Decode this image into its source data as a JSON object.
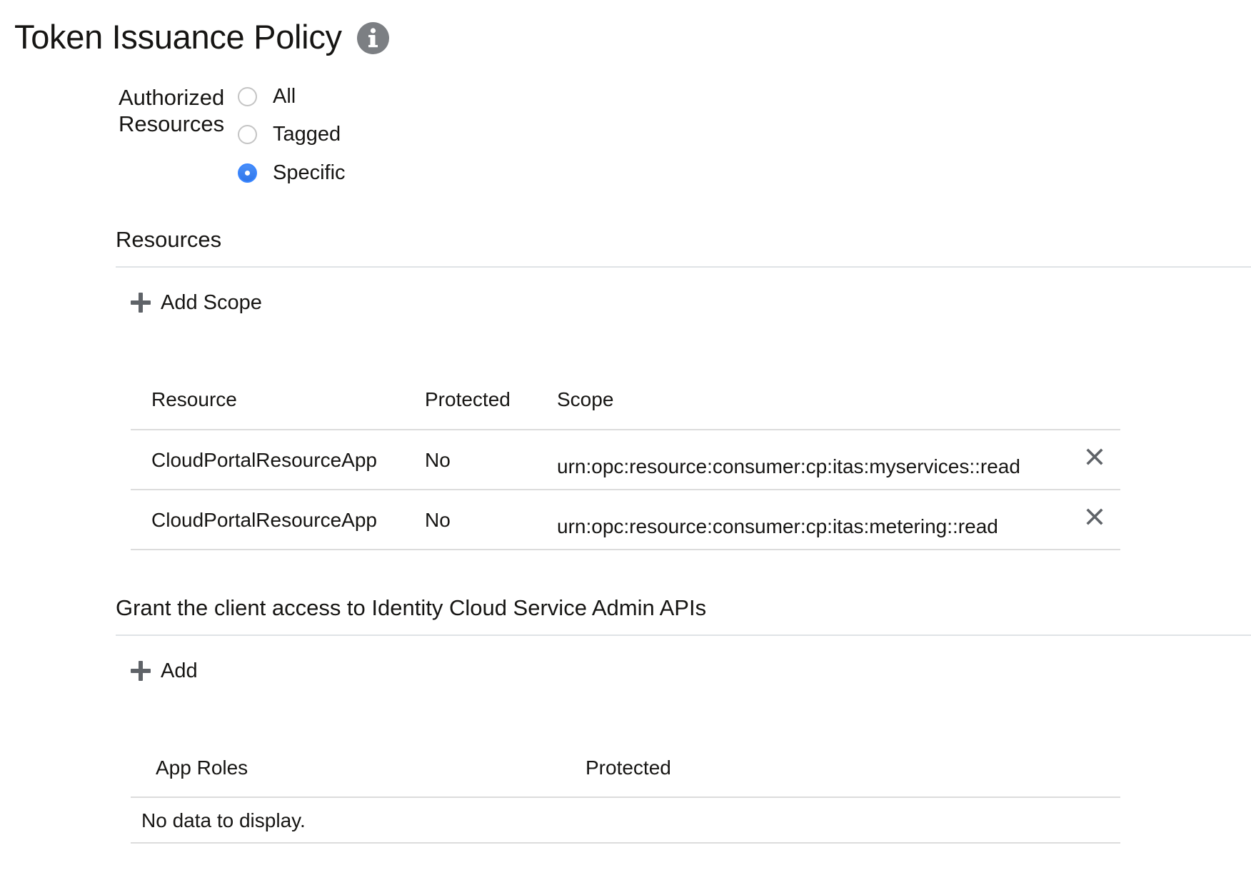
{
  "header": {
    "title": "Token Issuance Policy",
    "info_icon": "info-icon"
  },
  "authorized_resources": {
    "label_line1": "Authorized",
    "label_line2": "Resources",
    "options": [
      {
        "label": "All",
        "checked": false
      },
      {
        "label": "Tagged",
        "checked": false
      },
      {
        "label": "Specific",
        "checked": true
      }
    ]
  },
  "resources_section": {
    "heading": "Resources",
    "add_label": "Add Scope",
    "add_icon": "plus-icon",
    "columns": [
      "Resource",
      "Protected",
      "Scope"
    ],
    "rows": [
      {
        "resource": "CloudPortalResourceApp",
        "protected": "No",
        "scope": "urn:opc:resource:consumer:cp:itas:myservices::read"
      },
      {
        "resource": "CloudPortalResourceApp",
        "protected": "No",
        "scope": "urn:opc:resource:consumer:cp:itas:metering::read"
      }
    ],
    "remove_icon": "close-icon"
  },
  "admin_api_section": {
    "heading": "Grant the client access to Identity Cloud Service Admin APIs",
    "add_label": "Add",
    "add_icon": "plus-icon",
    "columns": [
      "App Roles",
      "Protected"
    ],
    "empty_text": "No data to display."
  },
  "colors": {
    "text": "#161513",
    "icon_gray": "#5f6368",
    "radio_checked": "#3a86ff",
    "divider": "#dcdcdc"
  }
}
